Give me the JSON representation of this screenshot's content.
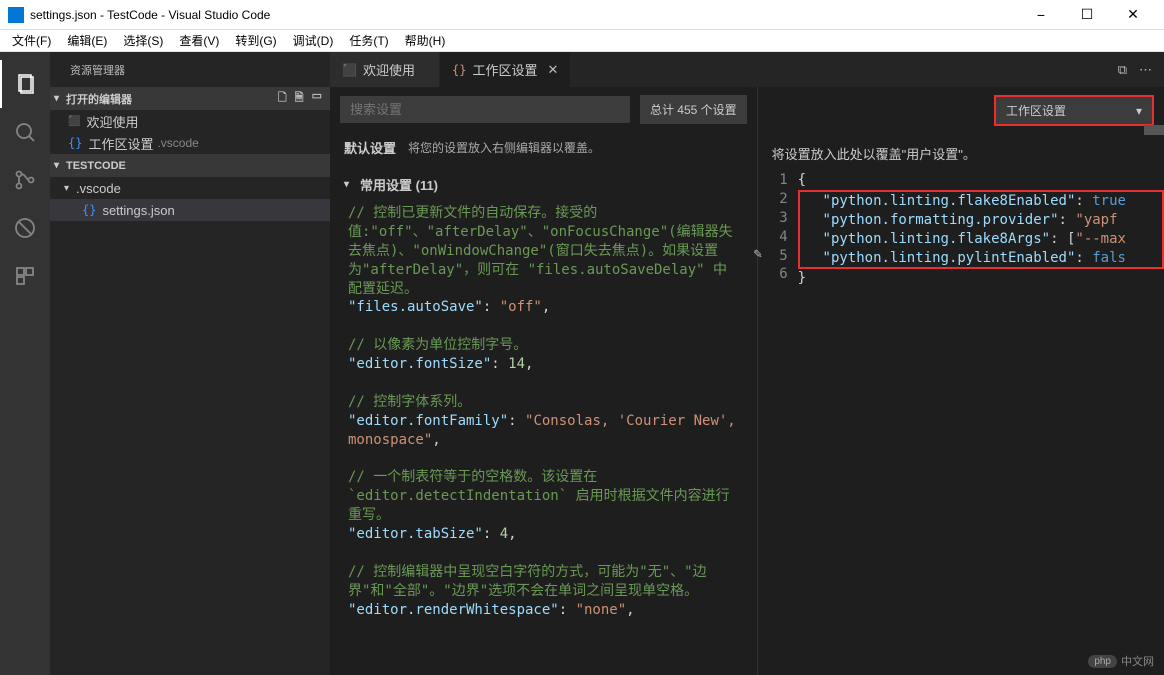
{
  "title": "settings.json - TestCode - Visual Studio Code",
  "menubar": [
    "文件(F)",
    "编辑(E)",
    "选择(S)",
    "查看(V)",
    "转到(G)",
    "调试(D)",
    "任务(T)",
    "帮助(H)"
  ],
  "sidebar": {
    "title": "资源管理器",
    "sections": {
      "openEditors": {
        "label": "打开的编辑器",
        "items": [
          {
            "label": "欢迎使用",
            "type": "vs"
          },
          {
            "label": "工作区设置",
            "dim": ".vscode",
            "type": "json"
          }
        ]
      },
      "project": {
        "label": "TESTCODE",
        "folder": ".vscode",
        "file": "settings.json"
      }
    }
  },
  "tabs": [
    {
      "icon": "⬛",
      "iconColor": "#0078d4",
      "label": "欢迎使用"
    },
    {
      "icon": "{}",
      "iconColor": "#ce9178",
      "label": "工作区设置",
      "active": true
    }
  ],
  "search": {
    "placeholder": "搜索设置",
    "count": "总计 455 个设置",
    "scope": "工作区设置"
  },
  "leftPane": {
    "header": {
      "label": "默认设置",
      "desc": "将您的设置放入右侧编辑器以覆盖。"
    },
    "groupTitle": "常用设置 (11)",
    "entries": [
      {
        "comment": "// 控制已更新文件的自动保存。接受的值:\"off\"、\"afterDelay\"、\"onFocusChange\"(编辑器失去焦点)、\"onWindowChange\"(窗口失去焦点)。如果设置为\"afterDelay\"，则可在 \"files.autoSaveDelay\" 中配置延迟。",
        "key": "files.autoSave",
        "value": "\"off\"",
        "valueClass": "str"
      },
      {
        "comment": "// 以像素为单位控制字号。",
        "key": "editor.fontSize",
        "value": "14",
        "valueClass": "num"
      },
      {
        "comment": "// 控制字体系列。",
        "key": "editor.fontFamily",
        "value": "\"Consolas, 'Courier New', monospace\"",
        "valueClass": "str"
      },
      {
        "comment": "// 一个制表符等于的空格数。该设置在 `editor.detectIndentation` 启用时根据文件内容进行重写。",
        "key": "editor.tabSize",
        "value": "4",
        "valueClass": "num"
      },
      {
        "comment": "// 控制编辑器中呈现空白字符的方式，可能为\"无\"、\"边界\"和\"全部\"。\"边界\"选项不会在单词之间呈现单空格。",
        "key": "editor.renderWhitespace",
        "value": "\"none\"",
        "valueClass": "str"
      }
    ]
  },
  "rightPane": {
    "header": "将设置放入此处以覆盖\"用户设置\"。",
    "lineStart": 1,
    "lines": [
      {
        "n": 1,
        "raw": "{"
      },
      {
        "n": 2,
        "key": "python.linting.flake8Enabled",
        "value": "true",
        "vc": "bool"
      },
      {
        "n": 3,
        "key": "python.formatting.provider",
        "value": "\"yapf",
        "vc": "str"
      },
      {
        "n": 4,
        "key": "python.linting.flake8Args",
        "value": "[\"--max",
        "vc": "str",
        "bracket": "["
      },
      {
        "n": 5,
        "key": "python.linting.pylintEnabled",
        "value": "fals",
        "vc": "bool"
      },
      {
        "n": 6,
        "raw": "}"
      }
    ]
  },
  "watermark": "中文网"
}
